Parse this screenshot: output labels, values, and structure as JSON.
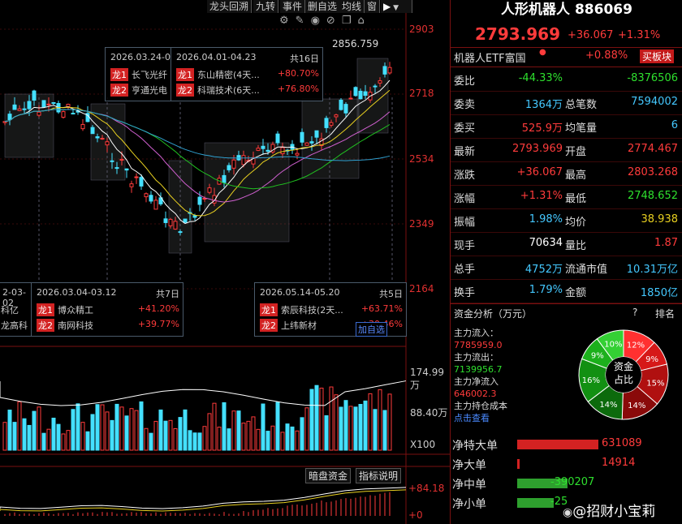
{
  "toolbar": {
    "items": [
      "龙头回溯",
      "九转",
      "事件",
      "删自选",
      "均线",
      "窗"
    ],
    "icons": [
      "gear-icon",
      "brush-icon",
      "eye-icon",
      "eye-off-icon",
      "copy-icon",
      "home-icon",
      "dropdown-icon"
    ]
  },
  "price_axis": {
    "labels": [
      "2903",
      "2718",
      "2534",
      "2349",
      "2164"
    ],
    "high_marker": "2856.759"
  },
  "volume_axis": {
    "labels": [
      "174.99万",
      "88.40万",
      "X100"
    ]
  },
  "macd_axis": {
    "labels": [
      "+84.18",
      "+0"
    ]
  },
  "bottom_tabs": {
    "items": [
      "暗盘资金",
      "指标说明"
    ]
  },
  "popups": {
    "p1": {
      "date": "2026.03.24-0",
      "rows": [
        {
          "tag": "龙1",
          "name": "长飞光纤"
        },
        {
          "tag": "龙2",
          "name": "亨通光电"
        }
      ]
    },
    "p2": {
      "date": "2026.04.01-04.23",
      "days": "共16日",
      "rows": [
        {
          "tag": "龙1",
          "name": "东山精密(4天...",
          "pct": "+80.70%"
        },
        {
          "tag": "龙2",
          "name": "科瑞技术(6天...",
          "pct": "+76.80%"
        }
      ]
    },
    "p3": {
      "date": "2-03-02",
      "rows": [
        {
          "name": "科亿"
        },
        {
          "name": "龙高科"
        }
      ]
    },
    "p4": {
      "date": "2026.03.04-03.12",
      "days": "共7日",
      "rows": [
        {
          "tag": "龙1",
          "name": "博众精工",
          "pct": "+41.20%"
        },
        {
          "tag": "龙2",
          "name": "南网科技",
          "pct": "+39.77%"
        }
      ]
    },
    "p5": {
      "date": "2026.05.14-05.20",
      "days": "共5日",
      "rows": [
        {
          "tag": "龙1",
          "name": "索辰科技(2天...",
          "pct": "+63.71%"
        },
        {
          "tag": "龙2",
          "name": "上纬新材",
          "pct": "+30.46%"
        }
      ],
      "button": "加自选"
    }
  },
  "stock": {
    "name": "人形机器人",
    "code": "886069",
    "price": "2793.969",
    "change": "+36.067",
    "change_pct": "+1.31%"
  },
  "etf": {
    "name": "机器人ETF富国",
    "pct": "+0.88%",
    "button": "买板块"
  },
  "quote_rows": [
    {
      "l1": "委比",
      "v1": "-44.33%",
      "c1": "green",
      "l2": "",
      "v2": "-8376506",
      "c2": "green"
    },
    {
      "l1": "委卖",
      "v1": "1364万",
      "c1": "cyan",
      "l2": "总笔数",
      "v2": "7594002",
      "c2": "cyan"
    },
    {
      "l1": "委买",
      "v1": "525.9万",
      "c1": "red",
      "l2": "均笔量",
      "v2": "6",
      "c2": "cyan"
    },
    {
      "l1": "最新",
      "v1": "2793.969",
      "c1": "red",
      "l2": "开盘",
      "v2": "2774.467",
      "c2": "red"
    },
    {
      "l1": "涨跌",
      "v1": "+36.067",
      "c1": "red",
      "l2": "最高",
      "v2": "2803.268",
      "c2": "red"
    },
    {
      "l1": "涨幅",
      "v1": "+1.31%",
      "c1": "red",
      "l2": "最低",
      "v2": "2748.652",
      "c2": "green"
    },
    {
      "l1": "振幅",
      "v1": "1.98%",
      "c1": "cyan",
      "l2": "均价",
      "v2": "38.938",
      "c2": "yellow"
    },
    {
      "l1": "现手",
      "v1": "70634",
      "c1": "white",
      "l2": "量比",
      "v2": "1.87",
      "c2": "red"
    },
    {
      "l1": "总手",
      "v1": "4752万",
      "c1": "cyan",
      "l2": "流通市值",
      "v2": "10.31万亿",
      "c2": "cyan"
    },
    {
      "l1": "换手",
      "v1": "1.79%",
      "c1": "cyan",
      "l2": "金额",
      "v2": "1850亿",
      "c2": "cyan"
    }
  ],
  "fund": {
    "title": "资金分析（万元）",
    "rank_label": "排名",
    "inflow_label": "主力流入：",
    "inflow": "7785959.0",
    "outflow_label": "主力流出：",
    "outflow": "7139956.7",
    "net_label": "主力净流入",
    "net": "646002.3",
    "cost_label": "主力持仓成本",
    "cost_link": "点击查看",
    "donut_center": [
      "资金",
      "占比"
    ],
    "donut_slices": [
      {
        "label": "12%",
        "value": 12,
        "color": "#ff3030"
      },
      {
        "label": "9%",
        "value": 9,
        "color": "#d61818"
      },
      {
        "label": "15%",
        "value": 15,
        "color": "#b01010"
      },
      {
        "label": "14%",
        "value": 14,
        "color": "#8a0a0a"
      },
      {
        "label": "14%",
        "value": 14,
        "color": "#0c6a0c"
      },
      {
        "label": "16%",
        "value": 16,
        "color": "#129012"
      },
      {
        "label": "9%",
        "value": 9,
        "color": "#1cb01c"
      },
      {
        "label": "10%",
        "value": 10,
        "color": "#34d034"
      }
    ]
  },
  "net_rows": [
    {
      "label": "净特大单",
      "value": "631089",
      "frac": 1.0,
      "color": "#d32222",
      "vcolor": "red"
    },
    {
      "label": "净大单",
      "value": "14914",
      "frac": 0.025,
      "color": "#d32222",
      "vcolor": "red"
    },
    {
      "label": "净中单",
      "value": "-390207",
      "frac": 0.62,
      "color": "#2ea02e",
      "vcolor": "green"
    },
    {
      "label": "净小单",
      "value": "-25",
      "frac": 0.45,
      "color": "#2ea02e",
      "vcolor": "green"
    }
  ],
  "watermark": "@招财小宝莉",
  "colors": {
    "up": "#ff3b3b",
    "down": "#44e0ff",
    "bg": "#000000",
    "green": "#2ee02e"
  }
}
